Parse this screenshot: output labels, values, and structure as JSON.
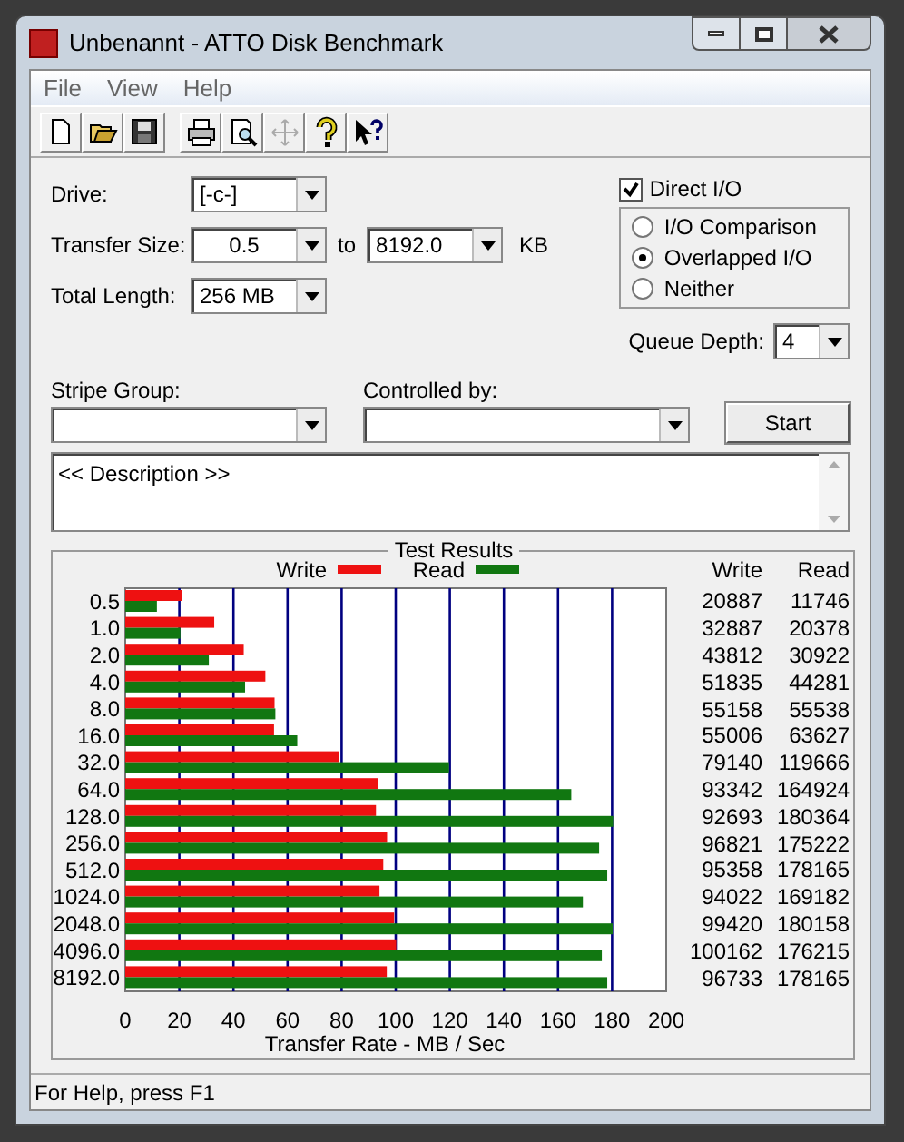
{
  "window": {
    "title": "Unbenannt - ATTO Disk Benchmark"
  },
  "menu": [
    "File",
    "View",
    "Help"
  ],
  "toolbar": [
    {
      "kind": "new",
      "disabled": false
    },
    {
      "kind": "open",
      "disabled": false
    },
    {
      "kind": "save",
      "disabled": false
    },
    {
      "kind": "print",
      "disabled": false
    },
    {
      "kind": "preview",
      "disabled": false
    },
    {
      "kind": "move",
      "disabled": true
    },
    {
      "kind": "help",
      "disabled": false
    },
    {
      "kind": "context_help",
      "disabled": false
    }
  ],
  "form": {
    "drive": {
      "label": "Drive:",
      "value": "[-c-]"
    },
    "transfer_size": {
      "label": "Transfer Size:",
      "from": "0.5",
      "to_label": "to",
      "to": "8192.0",
      "unit": "KB"
    },
    "total_length": {
      "label": "Total Length:",
      "value": "256 MB"
    },
    "direct_io": {
      "label": "Direct I/O",
      "checked": true
    },
    "io_modes": [
      {
        "label": "I/O Comparison",
        "selected": false
      },
      {
        "label": "Overlapped I/O",
        "selected": true
      },
      {
        "label": "Neither",
        "selected": false
      }
    ],
    "queue_depth": {
      "label": "Queue Depth:",
      "value": "4"
    },
    "stripe_group": {
      "label": "Stripe Group:"
    },
    "controlled_by": {
      "label": "Controlled by:"
    },
    "start_button": "Start",
    "description": "<< Description >>"
  },
  "results": {
    "title": "Test Results",
    "columns": [
      "Write",
      "Read"
    ],
    "rows": [
      [
        "20887",
        "11746"
      ],
      [
        "32887",
        "20378"
      ],
      [
        "43812",
        "30922"
      ],
      [
        "51835",
        "44281"
      ],
      [
        "55158",
        "55538"
      ],
      [
        "55006",
        "63627"
      ],
      [
        "79140",
        "119666"
      ],
      [
        "93342",
        "164924"
      ],
      [
        "92693",
        "180364"
      ],
      [
        "96821",
        "175222"
      ],
      [
        "95358",
        "178165"
      ],
      [
        "94022",
        "169182"
      ],
      [
        "99420",
        "180158"
      ],
      [
        "100162",
        "176215"
      ],
      [
        "96733",
        "178165"
      ]
    ],
    "chart_data": {
      "type": "bar",
      "orientation": "horizontal",
      "xlabel": "Transfer Rate - MB / Sec",
      "categories": [
        "0.5",
        "1.0",
        "2.0",
        "4.0",
        "8.0",
        "16.0",
        "32.0",
        "64.0",
        "128.0",
        "256.0",
        "512.0",
        "1024.0",
        "2048.0",
        "4096.0",
        "8192.0"
      ],
      "series": [
        {
          "name": "Write",
          "color": "#ee1111",
          "values": [
            20.9,
            32.9,
            43.8,
            51.8,
            55.2,
            55.0,
            79.1,
            93.3,
            92.7,
            96.8,
            95.4,
            94.0,
            99.4,
            100.2,
            96.7
          ]
        },
        {
          "name": "Read",
          "color": "#117711",
          "values": [
            11.7,
            20.4,
            30.9,
            44.3,
            55.5,
            63.6,
            119.7,
            164.9,
            180.4,
            175.2,
            178.2,
            169.2,
            180.2,
            176.2,
            178.2
          ]
        }
      ],
      "grid": true,
      "legend": true,
      "xlim": [
        0,
        200
      ],
      "xticks": [
        0,
        20,
        40,
        60,
        80,
        100,
        120,
        140,
        160,
        180,
        200
      ]
    }
  },
  "status_bar": "For Help, press F1"
}
